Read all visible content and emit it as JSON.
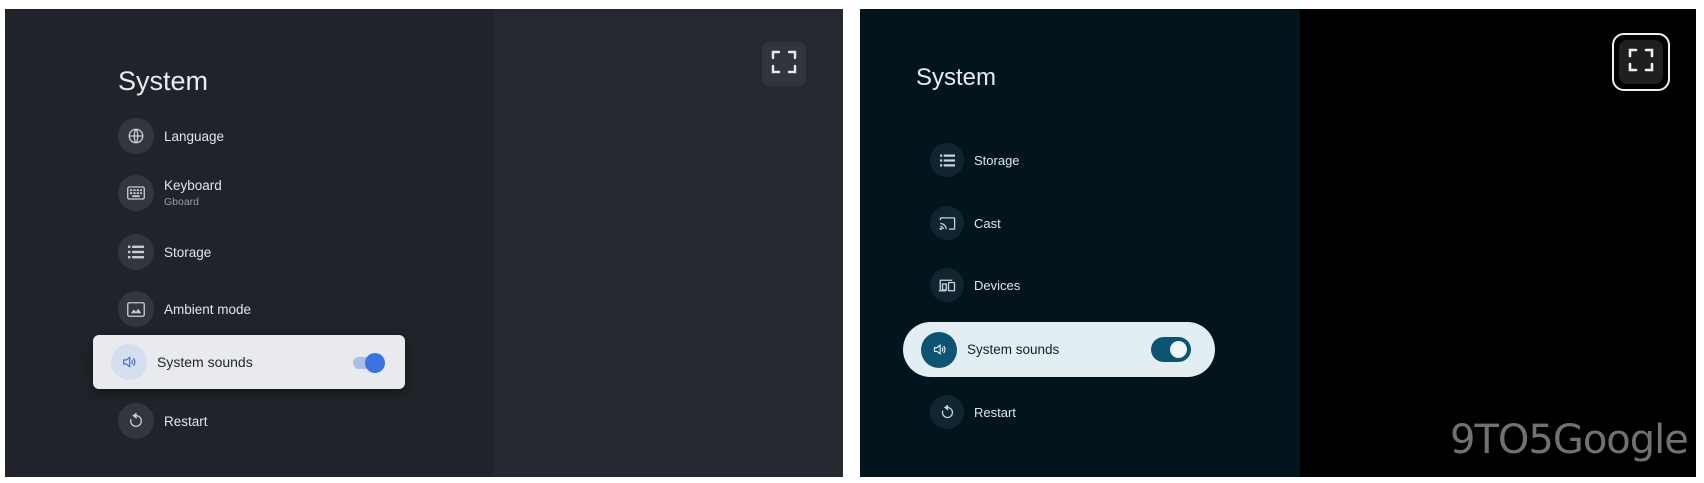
{
  "left": {
    "title": "System",
    "items": [
      {
        "label": "Language",
        "icon": "globe-icon"
      },
      {
        "label": "Keyboard",
        "sub": "Gboard",
        "icon": "keyboard-icon"
      },
      {
        "label": "Storage",
        "icon": "storage-icon"
      },
      {
        "label": "Ambient mode",
        "icon": "ambient-mode-icon"
      },
      {
        "label": "System sounds",
        "icon": "volume-icon",
        "focused": true,
        "toggle": "on"
      },
      {
        "label": "Restart",
        "icon": "restart-icon"
      }
    ],
    "fullscreen_icon": "fullscreen-icon",
    "colors": {
      "accent": "#3b74e0",
      "background": "#25282f"
    }
  },
  "right": {
    "title": "System",
    "items": [
      {
        "label": "Storage",
        "icon": "storage-icon"
      },
      {
        "label": "Cast",
        "icon": "cast-icon"
      },
      {
        "label": "Devices",
        "icon": "devices-icon"
      },
      {
        "label": "System sounds",
        "icon": "volume-icon",
        "focused": true,
        "toggle": "on"
      },
      {
        "label": "Restart",
        "icon": "restart-icon"
      }
    ],
    "fullscreen_icon": "fullscreen-icon",
    "watermark": "9TO5Google",
    "colors": {
      "accent": "#0c5472",
      "background": "#000000"
    }
  }
}
